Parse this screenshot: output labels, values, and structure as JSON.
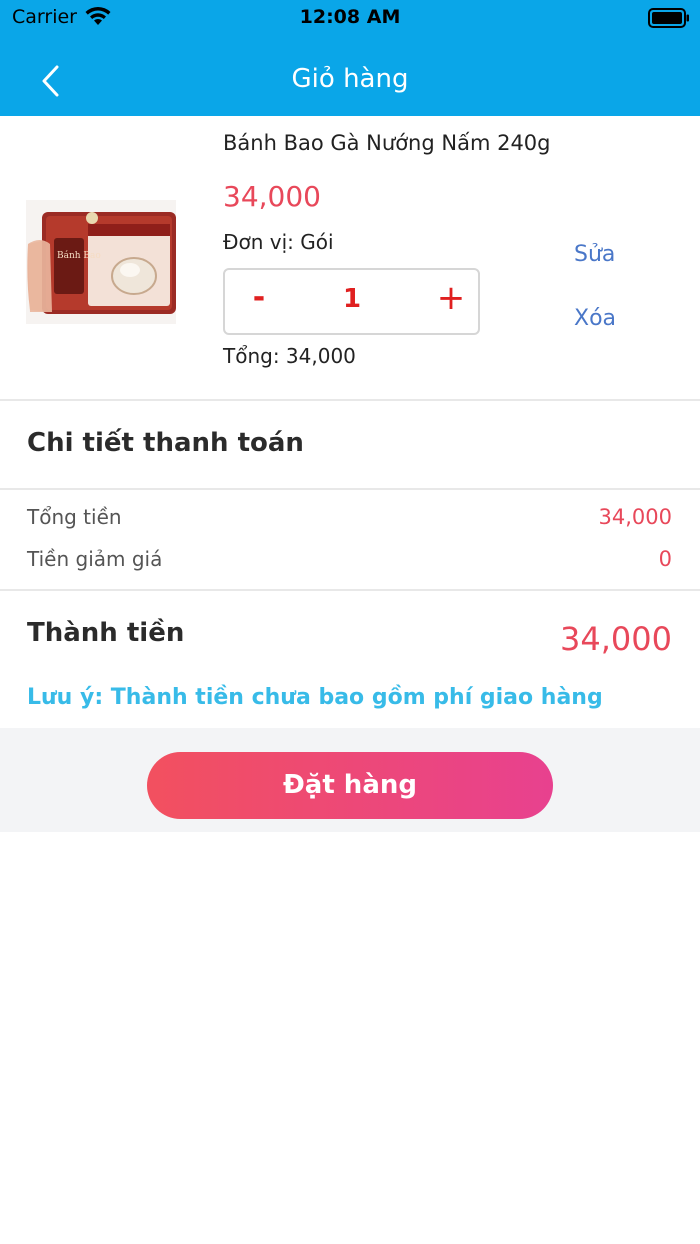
{
  "status_bar": {
    "carrier": "Carrier",
    "time": "12:08 AM"
  },
  "header": {
    "title": "Giỏ hàng"
  },
  "cart_item": {
    "name": "Bánh Bao Gà Nướng Nấm 240g",
    "price": "34,000",
    "unit": "Đơn vị: Gói",
    "quantity": "1",
    "minus_label": "-",
    "plus_label": "+",
    "total": "Tổng: 34,000",
    "edit_label": "Sửa",
    "delete_label": "Xóa",
    "image_text": "Bánh Bao"
  },
  "payment": {
    "title": "Chi tiết thanh toán",
    "subtotal_label": "Tổng tiền",
    "subtotal_value": "34,000",
    "discount_label": "Tiền giảm giá",
    "discount_value": "0",
    "grand_label": "Thành tiền",
    "grand_value": "34,000",
    "note": "Lưu ý: Thành tiền chưa bao gồm phí giao hàng"
  },
  "footer": {
    "order_button": "Đặt hàng"
  },
  "colors": {
    "header": "#0aa6e8",
    "price": "#e8485a",
    "link": "#4a77c8",
    "note": "#38bbe8",
    "stepper": "#e02020"
  }
}
